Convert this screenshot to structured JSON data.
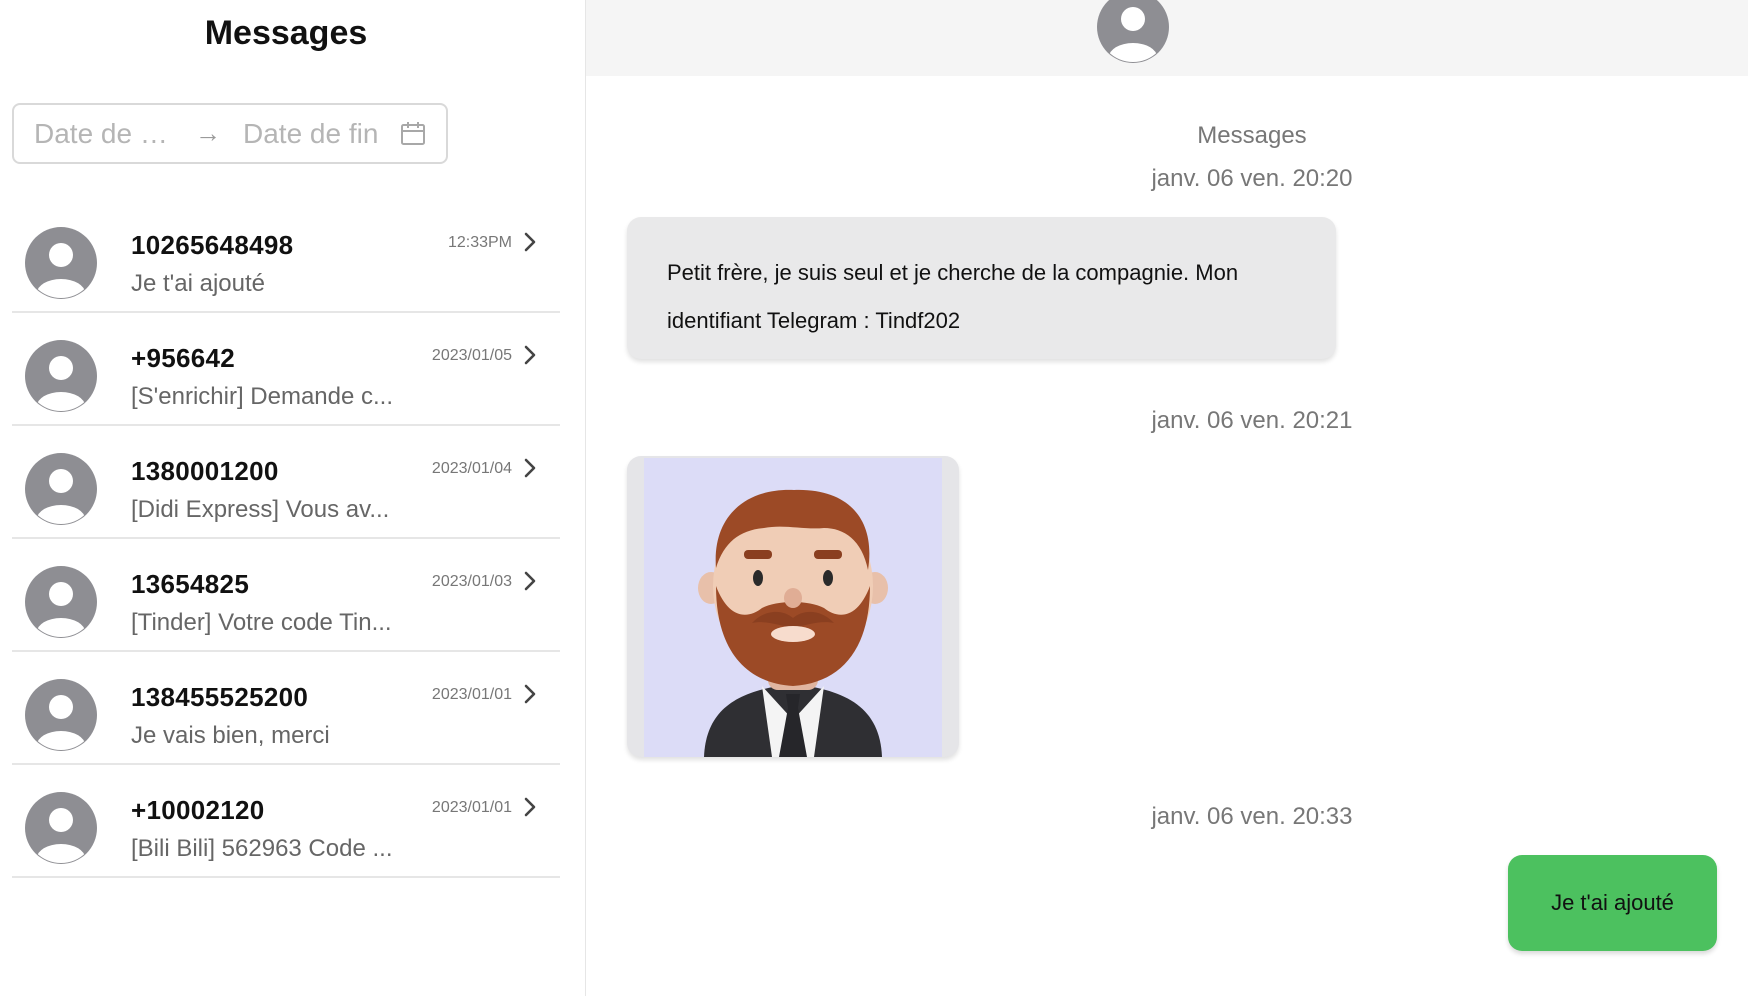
{
  "sidebar": {
    "title": "Messages",
    "date_filter": {
      "start_placeholder": "Date de d...",
      "arrow": "→",
      "end_placeholder": "Date de fin",
      "icon": "calendar-icon"
    },
    "conversations": [
      {
        "name": "10265648498",
        "time": "12:33PM",
        "preview": "Je t'ai ajouté"
      },
      {
        "name": "+956642",
        "time": "2023/01/05",
        "preview": "[S'enrichir] Demande c..."
      },
      {
        "name": "1380001200",
        "time": "2023/01/04",
        "preview": "[Didi Express] Vous av..."
      },
      {
        "name": "13654825",
        "time": "2023/01/03",
        "preview": "[Tinder] Votre code Tin..."
      },
      {
        "name": "138455525200",
        "time": "2023/01/01",
        "preview": "Je vais bien, merci"
      },
      {
        "name": "+10002120",
        "time": "2023/01/01",
        "preview": "[Bili Bili] 562963 Code ..."
      }
    ]
  },
  "chat": {
    "label": "Messages",
    "messages": [
      {
        "timestamp": "janv. 06 ven. 20:20",
        "type": "incoming-text",
        "text": "Petit frère, je suis seul et je cherche de la compagnie. Mon identifiant Telegram : Tindf202"
      },
      {
        "timestamp": "janv. 06 ven. 20:21",
        "type": "incoming-image",
        "image": "bearded-man-avatar"
      },
      {
        "timestamp": "janv. 06 ven. 20:33",
        "type": "outgoing-text",
        "text": "Je t'ai ajouté"
      }
    ]
  },
  "colors": {
    "outgoing_bubble": "#4cc15f",
    "incoming_bubble": "#e9e9ea",
    "avatar": "#8e8e93",
    "header_bg": "#f5f5f5"
  }
}
